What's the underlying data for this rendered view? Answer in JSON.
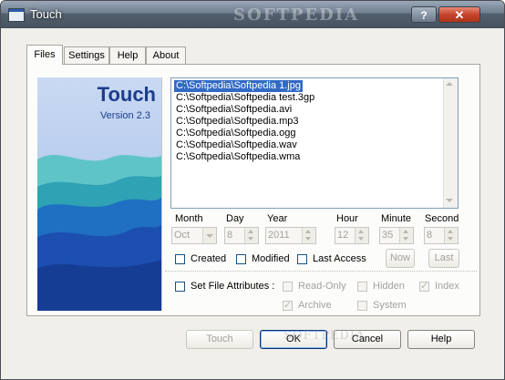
{
  "window": {
    "title": "Touch",
    "watermark": "SOFTPEDIA",
    "bottom_watermark": "SOFTPEDIA"
  },
  "titlebar_buttons": {
    "help": "?",
    "close": "✕"
  },
  "tabs": [
    {
      "label": "Files",
      "active": true
    },
    {
      "label": "Settings"
    },
    {
      "label": "Help"
    },
    {
      "label": "About"
    }
  ],
  "logo": {
    "title": "Touch",
    "version": "Version 2.3"
  },
  "files": [
    {
      "path": "C:\\Softpedia\\Softpedia 1.jpg",
      "selected": true
    },
    {
      "path": "C:\\Softpedia\\Softpedia test.3gp"
    },
    {
      "path": "C:\\Softpedia\\Softpedia.avi"
    },
    {
      "path": "C:\\Softpedia\\Softpedia.mp3"
    },
    {
      "path": "C:\\Softpedia\\Softpedia.ogg"
    },
    {
      "path": "C:\\Softpedia\\Softpedia.wav"
    },
    {
      "path": "C:\\Softpedia\\Softpedia.wma"
    }
  ],
  "date": {
    "month_label": "Month",
    "month_value": "Oct",
    "day_label": "Day",
    "day_value": "8",
    "year_label": "Year",
    "year_value": "2011",
    "hour_label": "Hour",
    "hour_value": "12",
    "minute_label": "Minute",
    "minute_value": "35",
    "second_label": "Second",
    "second_value": "8"
  },
  "options": {
    "created": "Created",
    "modified": "Modified",
    "last_access": "Last Access",
    "now_button": "Now",
    "last_button": "Last"
  },
  "attributes": {
    "set_label": "Set File Attributes :",
    "read_only": "Read-Only",
    "hidden": "Hidden",
    "index": "Index",
    "archive": "Archive",
    "system": "System"
  },
  "buttons": {
    "touch": "Touch",
    "ok": "OK",
    "cancel": "Cancel",
    "help": "Help"
  },
  "colors": {
    "selection": "#316ac5",
    "logo_text": "#1b3d8c"
  }
}
